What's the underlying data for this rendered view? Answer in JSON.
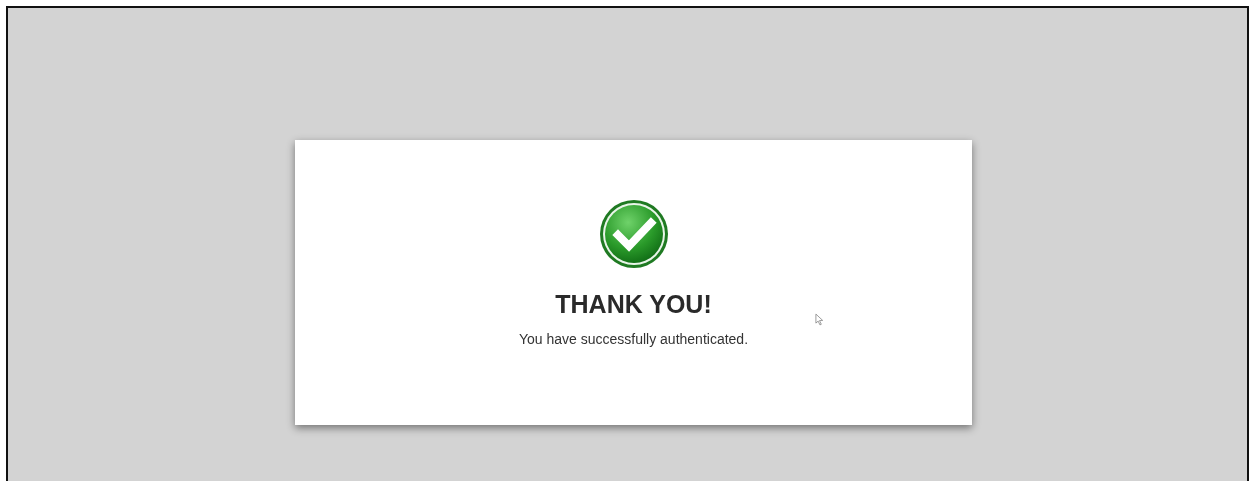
{
  "card": {
    "title": "THANK YOU!",
    "message": "You have successfully authenticated."
  }
}
